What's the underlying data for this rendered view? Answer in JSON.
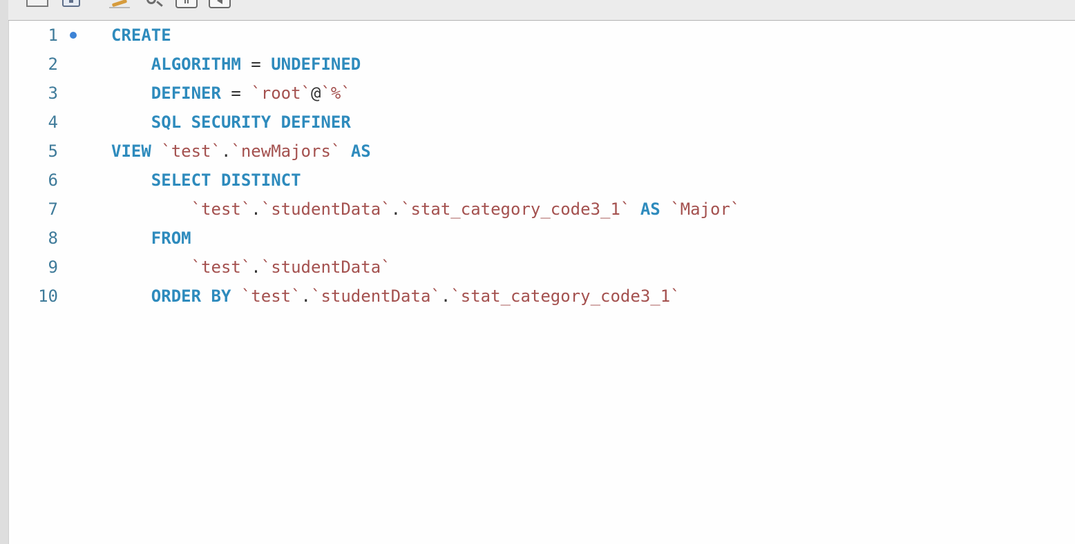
{
  "toolbar": {
    "buttons": [
      "panel-icon",
      "save-icon",
      "beautify-icon",
      "find-icon",
      "pause-icon",
      "back-icon"
    ]
  },
  "editor": {
    "lines": [
      {
        "num": "1",
        "marker": true,
        "indent": "",
        "tokens": [
          {
            "t": "CREATE",
            "k": "kw"
          }
        ]
      },
      {
        "num": "2",
        "marker": false,
        "indent": "    ",
        "tokens": [
          {
            "t": "ALGORITHM",
            "k": "kw"
          },
          {
            "t": " = ",
            "k": "op"
          },
          {
            "t": "UNDEFINED",
            "k": "kw"
          }
        ]
      },
      {
        "num": "3",
        "marker": false,
        "indent": "    ",
        "tokens": [
          {
            "t": "DEFINER",
            "k": "kw"
          },
          {
            "t": " = ",
            "k": "op"
          },
          {
            "t": "`root`",
            "k": "str"
          },
          {
            "t": "@",
            "k": "op"
          },
          {
            "t": "`%`",
            "k": "str"
          }
        ]
      },
      {
        "num": "4",
        "marker": false,
        "indent": "    ",
        "tokens": [
          {
            "t": "SQL SECURITY DEFINER",
            "k": "kw"
          }
        ]
      },
      {
        "num": "5",
        "marker": false,
        "indent": "",
        "tokens": [
          {
            "t": "VIEW",
            "k": "kw"
          },
          {
            "t": " ",
            "k": "op"
          },
          {
            "t": "`test`",
            "k": "str"
          },
          {
            "t": ".",
            "k": "op"
          },
          {
            "t": "`newMajors`",
            "k": "str"
          },
          {
            "t": " ",
            "k": "op"
          },
          {
            "t": "AS",
            "k": "kw"
          }
        ]
      },
      {
        "num": "6",
        "marker": false,
        "indent": "    ",
        "tokens": [
          {
            "t": "SELECT DISTINCT",
            "k": "kw"
          }
        ]
      },
      {
        "num": "7",
        "marker": false,
        "indent": "        ",
        "tokens": [
          {
            "t": "`test`",
            "k": "str"
          },
          {
            "t": ".",
            "k": "op"
          },
          {
            "t": "`studentData`",
            "k": "str"
          },
          {
            "t": ".",
            "k": "op"
          },
          {
            "t": "`stat_category_code3_1`",
            "k": "str"
          },
          {
            "t": " ",
            "k": "op"
          },
          {
            "t": "AS",
            "k": "kw"
          },
          {
            "t": " ",
            "k": "op"
          },
          {
            "t": "`Major`",
            "k": "str"
          }
        ]
      },
      {
        "num": "8",
        "marker": false,
        "indent": "    ",
        "tokens": [
          {
            "t": "FROM",
            "k": "kw"
          }
        ]
      },
      {
        "num": "9",
        "marker": false,
        "indent": "        ",
        "tokens": [
          {
            "t": "`test`",
            "k": "str"
          },
          {
            "t": ".",
            "k": "op"
          },
          {
            "t": "`studentData`",
            "k": "str"
          }
        ]
      },
      {
        "num": "10",
        "marker": false,
        "indent": "    ",
        "tokens": [
          {
            "t": "ORDER BY",
            "k": "kw"
          },
          {
            "t": " ",
            "k": "op"
          },
          {
            "t": "`test`",
            "k": "str"
          },
          {
            "t": ".",
            "k": "op"
          },
          {
            "t": "`studentData`",
            "k": "str"
          },
          {
            "t": ".",
            "k": "op"
          },
          {
            "t": "`stat_category_code3_1`",
            "k": "str"
          }
        ]
      }
    ]
  },
  "colors": {
    "keyword": "#2e8bbd",
    "string": "#a4514f",
    "operator": "#333333",
    "line_number": "#3f7b9a",
    "marker": "#3d83d6"
  }
}
